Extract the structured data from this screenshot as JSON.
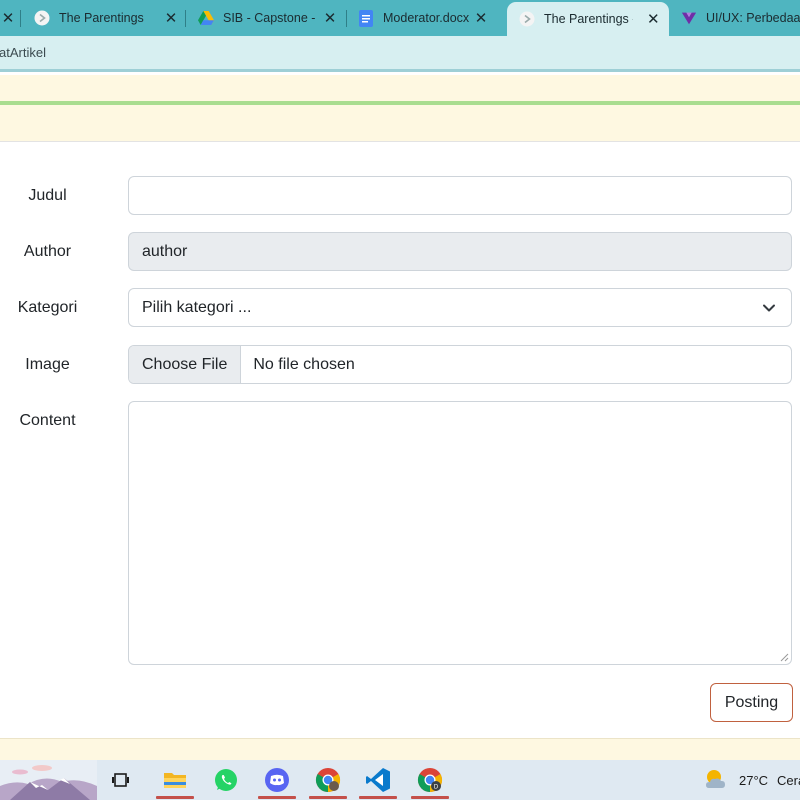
{
  "browser": {
    "tabs": [
      {
        "title": "",
        "close": "✕"
      },
      {
        "title": "The Parentings",
        "close": "✕"
      },
      {
        "title": "SIB - Capstone -",
        "close": "✕"
      },
      {
        "title": "Moderator.docx",
        "close": "✕"
      },
      {
        "title": "The Parentings -",
        "close": "✕",
        "active": true
      },
      {
        "title": "UI/UX: Perbedaa",
        "close": ""
      }
    ],
    "bookmark_bar_text": "atArtikel"
  },
  "form": {
    "judul": {
      "label": "Judul",
      "value": ""
    },
    "author": {
      "label": "Author",
      "value": "author"
    },
    "kategori": {
      "label": "Kategori",
      "selected": "Pilih kategori ..."
    },
    "image": {
      "label": "Image",
      "button": "Choose File",
      "status": "No file chosen"
    },
    "content": {
      "label": "Content",
      "value": ""
    },
    "submit_label": "Posting"
  },
  "taskbar": {
    "icons": [
      "widgets-icon",
      "task-view-icon",
      "file-explorer-icon",
      "whatsapp-icon",
      "discord-icon",
      "chrome-icon",
      "vscode-icon",
      "chrome-profile-icon"
    ],
    "weather": {
      "temp": "27°C",
      "condition": "Cera"
    }
  },
  "colors": {
    "tabstrip": "#4fb5c0",
    "header_band": "#fef8e1",
    "accent_green": "#a9dd8f",
    "posting_border": "#c0613f",
    "taskbar_underline": "#c4504a"
  }
}
